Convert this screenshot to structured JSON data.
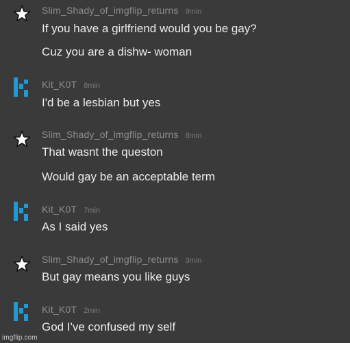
{
  "messages": [
    {
      "avatar": "star-icon",
      "username": "Slim_Shady_of_imgflip_returns",
      "time": "9min",
      "lines": [
        "If you have a girlfriend would you be gay?",
        "Cuz you are a dishw- woman"
      ]
    },
    {
      "avatar": "kik-logo-icon",
      "username": "Kit_K0T",
      "time": "8min",
      "lines": [
        "I'd be a lesbian but yes"
      ]
    },
    {
      "avatar": "star-icon",
      "username": "Slim_Shady_of_imgflip_returns",
      "time": "8min",
      "lines": [
        "That wasnt the queston",
        "Would gay be an acceptable term"
      ]
    },
    {
      "avatar": "kik-logo-icon",
      "username": "Kit_K0T",
      "time": "7min",
      "lines": [
        "As I said yes"
      ]
    },
    {
      "avatar": "star-icon",
      "username": "Slim_Shady_of_imgflip_returns",
      "time": "3min",
      "lines": [
        "But gay means you like guys"
      ]
    },
    {
      "avatar": "kik-logo-icon",
      "username": "Kit_K0T",
      "time": "2min",
      "lines": [
        "God I've confused my self"
      ]
    }
  ],
  "watermark": "imgflip.com",
  "colors": {
    "background": "#3a3a3a",
    "username": "#8e8e8e",
    "message_text": "#ececec",
    "kik_blue": "#1e9bd7"
  }
}
